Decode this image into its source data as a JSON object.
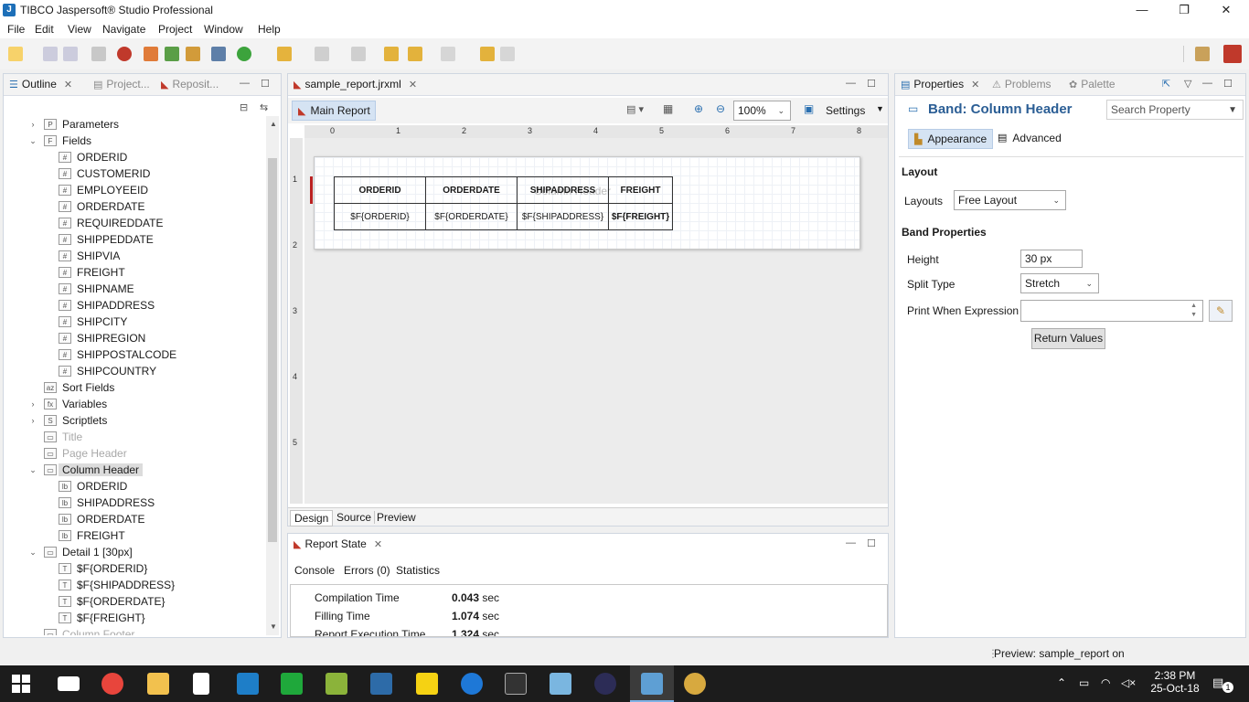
{
  "window": {
    "title": "TIBCO Jaspersoft® Studio Professional"
  },
  "menu": [
    "File",
    "Edit",
    "View",
    "Navigate",
    "Project",
    "Window",
    "Help"
  ],
  "outline": {
    "tabs": [
      {
        "label": "Outline"
      },
      {
        "label": "Project..."
      },
      {
        "label": "Reposit..."
      }
    ],
    "tree": [
      {
        "label": "Parameters",
        "indent": 0,
        "twisty": "›",
        "icon": "P"
      },
      {
        "label": "Fields",
        "indent": 0,
        "twisty": "⌄",
        "icon": "F"
      },
      {
        "label": "ORDERID",
        "indent": 1,
        "icon": "#"
      },
      {
        "label": "CUSTOMERID",
        "indent": 1,
        "icon": "#"
      },
      {
        "label": "EMPLOYEEID",
        "indent": 1,
        "icon": "#"
      },
      {
        "label": "ORDERDATE",
        "indent": 1,
        "icon": "#"
      },
      {
        "label": "REQUIREDDATE",
        "indent": 1,
        "icon": "#"
      },
      {
        "label": "SHIPPEDDATE",
        "indent": 1,
        "icon": "#"
      },
      {
        "label": "SHIPVIA",
        "indent": 1,
        "icon": "#"
      },
      {
        "label": "FREIGHT",
        "indent": 1,
        "icon": "#"
      },
      {
        "label": "SHIPNAME",
        "indent": 1,
        "icon": "#"
      },
      {
        "label": "SHIPADDRESS",
        "indent": 1,
        "icon": "#"
      },
      {
        "label": "SHIPCITY",
        "indent": 1,
        "icon": "#"
      },
      {
        "label": "SHIPREGION",
        "indent": 1,
        "icon": "#"
      },
      {
        "label": "SHIPPOSTALCODE",
        "indent": 1,
        "icon": "#"
      },
      {
        "label": "SHIPCOUNTRY",
        "indent": 1,
        "icon": "#"
      },
      {
        "label": "Sort Fields",
        "indent": 0,
        "icon": "az"
      },
      {
        "label": "Variables",
        "indent": 0,
        "twisty": "›",
        "icon": "fx"
      },
      {
        "label": "Scriptlets",
        "indent": 0,
        "twisty": "›",
        "icon": "S"
      },
      {
        "label": "Title",
        "indent": 0,
        "icon": "▭",
        "grey": true
      },
      {
        "label": "Page Header",
        "indent": 0,
        "icon": "▭",
        "grey": true
      },
      {
        "label": "Column Header",
        "indent": 0,
        "twisty": "⌄",
        "icon": "▭",
        "selected": true
      },
      {
        "label": "ORDERID",
        "indent": 1,
        "icon": "lb"
      },
      {
        "label": "SHIPADDRESS",
        "indent": 1,
        "icon": "lb"
      },
      {
        "label": "ORDERDATE",
        "indent": 1,
        "icon": "lb"
      },
      {
        "label": "FREIGHT",
        "indent": 1,
        "icon": "lb"
      },
      {
        "label": "Detail 1 [30px]",
        "indent": 0,
        "twisty": "⌄",
        "icon": "▭"
      },
      {
        "label": "$F{ORDERID}",
        "indent": 1,
        "icon": "T"
      },
      {
        "label": "$F{SHIPADDRESS}",
        "indent": 1,
        "icon": "T"
      },
      {
        "label": "$F{ORDERDATE}",
        "indent": 1,
        "icon": "T"
      },
      {
        "label": "$F{FREIGHT}",
        "indent": 1,
        "icon": "T"
      },
      {
        "label": "Column Footer",
        "indent": 0,
        "icon": "▭",
        "grey": true
      }
    ]
  },
  "editor": {
    "tab": "sample_report.jrxml",
    "main_report": "Main Report",
    "zoom": "100%",
    "settings": "Settings",
    "ruler_numbers": [
      "0",
      "1",
      "2",
      "3",
      "4",
      "5",
      "6",
      "7",
      "8"
    ],
    "ruler_side": [
      "1",
      "2",
      "3",
      "4",
      "5"
    ],
    "band_watermark": "Column Header",
    "header_cells": [
      "ORDERID",
      "ORDERDATE",
      "SHIPADDRESS",
      "FREIGHT"
    ],
    "detail_cells": [
      "$F{ORDERID}",
      "$F{ORDERDATE}",
      "$F{SHIPADDRESS}",
      "$F{FREIGHT}"
    ],
    "bottom_tabs": [
      "Design",
      "Source",
      "Preview"
    ]
  },
  "report_state": {
    "tab": "Report State",
    "subtabs": [
      "Console",
      "Errors (0)",
      "Statistics"
    ],
    "rows": [
      {
        "label": "Compilation Time",
        "value": "0.043",
        "unit": "sec"
      },
      {
        "label": "Filling Time",
        "value": "1.074",
        "unit": "sec"
      },
      {
        "label": "Report Execution Time",
        "value": "1.324",
        "unit": "sec"
      }
    ]
  },
  "properties": {
    "tabs": [
      {
        "label": "Properties"
      },
      {
        "label": "Problems"
      },
      {
        "label": "Palette"
      }
    ],
    "band_title": "Band: Column Header",
    "search_placeholder": "Search Property",
    "subtabs": [
      "Appearance",
      "Advanced"
    ],
    "layout_section": "Layout",
    "layouts_label": "Layouts",
    "layouts_value": "Free Layout",
    "band_section": "Band Properties",
    "height_label": "Height",
    "height_value": "30 px",
    "split_label": "Split Type",
    "split_value": "Stretch",
    "print_when_label": "Print When Expression",
    "print_when_value": "",
    "return_values": "Return Values"
  },
  "status": {
    "text": "Preview: sample_report on"
  },
  "taskbar": {
    "time": "2:38 PM",
    "date": "25-Oct-18",
    "notif_count": "1"
  }
}
